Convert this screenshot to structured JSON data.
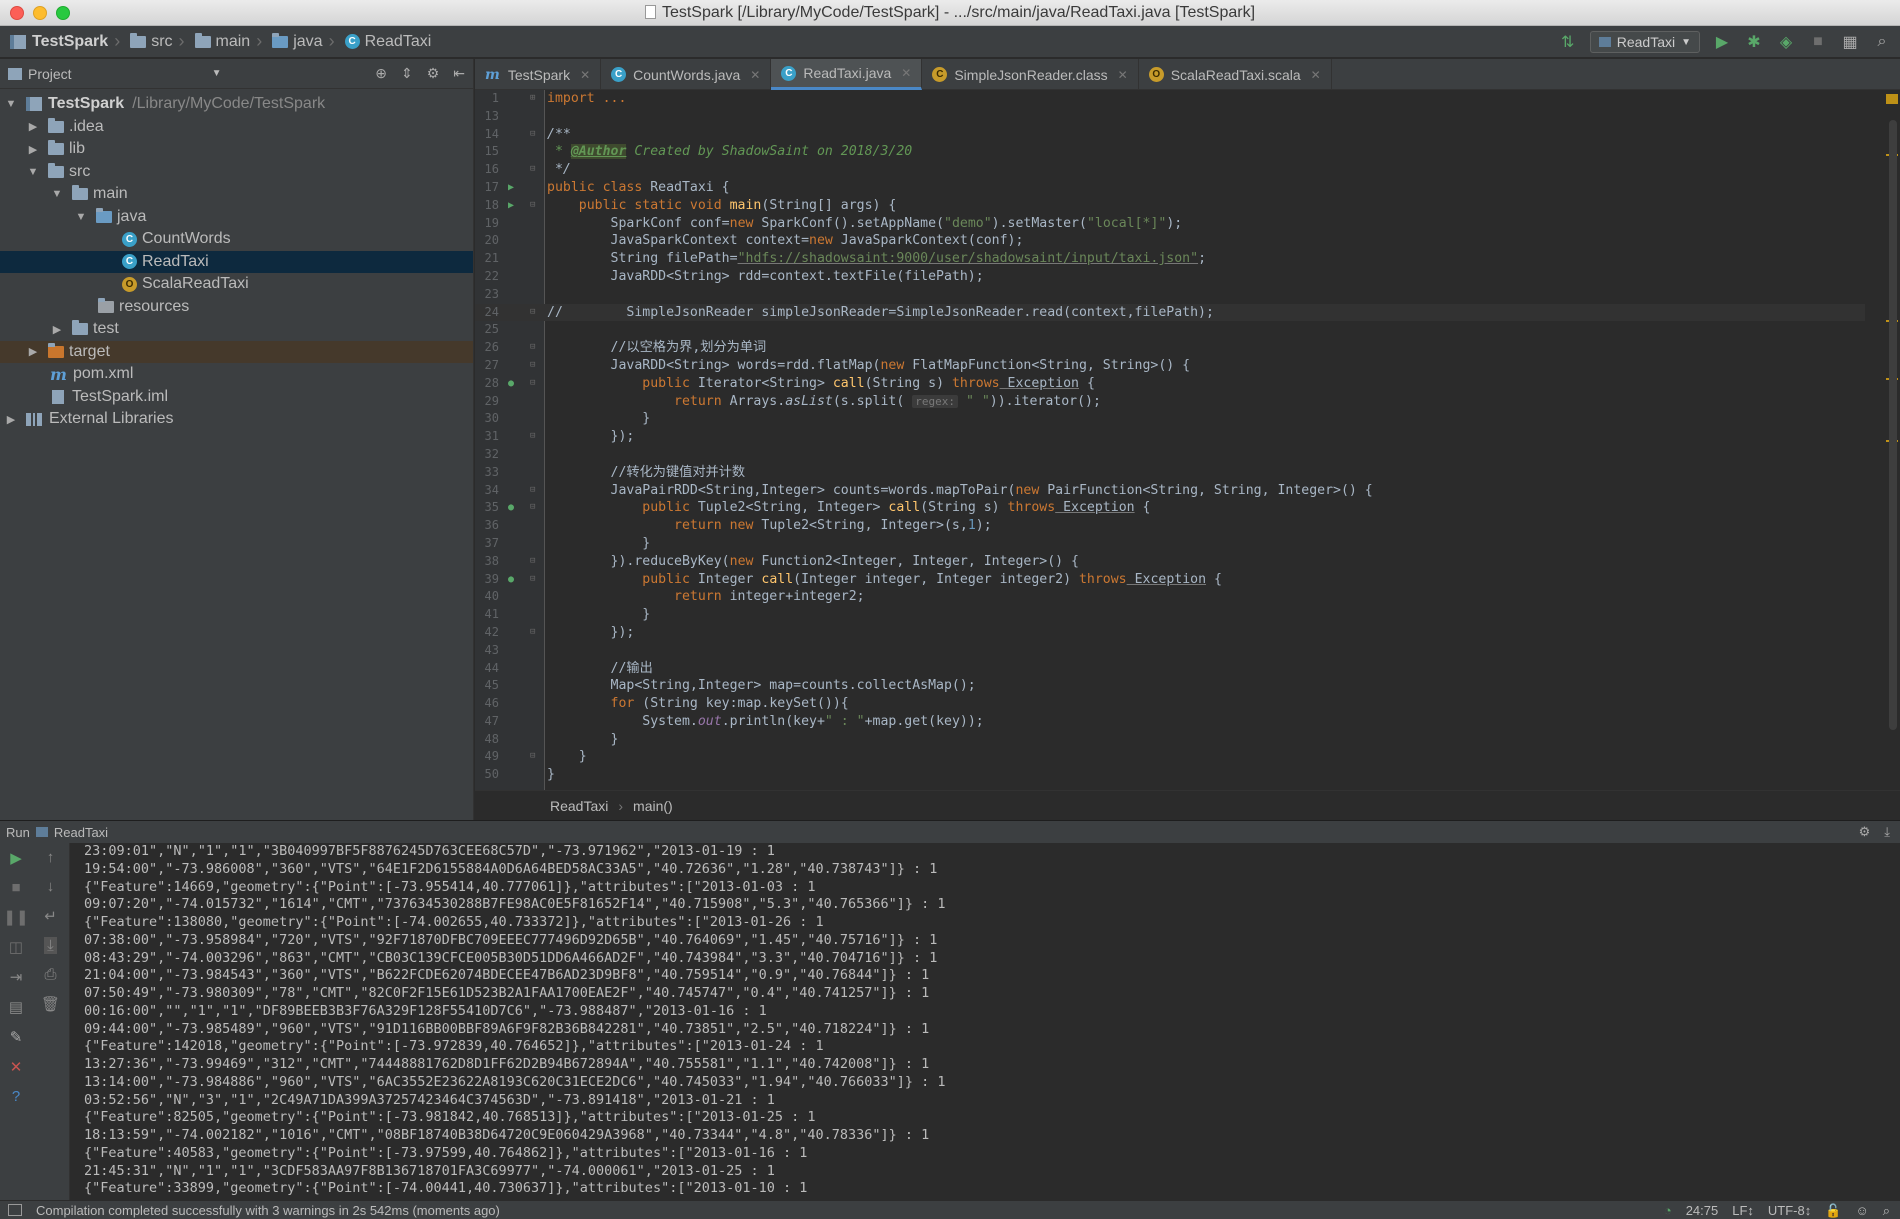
{
  "window": {
    "title": "TestSpark [/Library/MyCode/TestSpark] - .../src/main/java/ReadTaxi.java [TestSpark]"
  },
  "breadcrumbs": [
    "TestSpark",
    "src",
    "main",
    "java",
    "ReadTaxi"
  ],
  "toolbar": {
    "run_config": "ReadTaxi"
  },
  "project_panel": {
    "title": "Project",
    "tree": [
      {
        "label": "TestSpark",
        "path": "/Library/MyCode/TestSpark",
        "depth": 0,
        "expanded": true,
        "icon": "project-icon"
      },
      {
        "label": ".idea",
        "depth": 1,
        "expanded": false,
        "icon": "folder-icon"
      },
      {
        "label": "lib",
        "depth": 1,
        "expanded": false,
        "icon": "folder-icon"
      },
      {
        "label": "src",
        "depth": 1,
        "expanded": true,
        "icon": "folder-icon"
      },
      {
        "label": "main",
        "depth": 2,
        "expanded": true,
        "icon": "folder-icon"
      },
      {
        "label": "java",
        "depth": 3,
        "expanded": true,
        "icon": "source-folder-icon"
      },
      {
        "label": "CountWords",
        "depth": 4,
        "icon": "java-class-icon"
      },
      {
        "label": "ReadTaxi",
        "depth": 4,
        "icon": "java-class-icon",
        "selected": true
      },
      {
        "label": "ScalaReadTaxi",
        "depth": 4,
        "icon": "scala-object-icon"
      },
      {
        "label": "resources",
        "depth": 3,
        "icon": "resources-folder-icon"
      },
      {
        "label": "test",
        "depth": 2,
        "expanded": false,
        "icon": "folder-icon"
      },
      {
        "label": "target",
        "depth": 1,
        "expanded": false,
        "icon": "excluded-folder-icon"
      },
      {
        "label": "pom.xml",
        "depth": 1,
        "icon": "maven-icon"
      },
      {
        "label": "TestSpark.iml",
        "depth": 1,
        "icon": "module-file-icon"
      },
      {
        "label": "External Libraries",
        "depth": 0,
        "expanded": false,
        "icon": "libraries-icon"
      }
    ]
  },
  "tabs": [
    {
      "label": "TestSpark",
      "icon": "maven-icon"
    },
    {
      "label": "CountWords.java",
      "icon": "java-class-icon"
    },
    {
      "label": "ReadTaxi.java",
      "icon": "java-class-icon",
      "active": true
    },
    {
      "label": "SimpleJsonReader.class",
      "icon": "class-file-icon"
    },
    {
      "label": "ScalaReadTaxi.scala",
      "icon": "scala-object-icon"
    }
  ],
  "editor": {
    "line_numbers": [
      "1",
      "13",
      "14",
      "15",
      "16",
      "17",
      "18",
      "19",
      "20",
      "21",
      "22",
      "23",
      "24",
      "25",
      "26",
      "27",
      "28",
      "29",
      "30",
      "31",
      "32",
      "33",
      "34",
      "35",
      "36",
      "37",
      "38",
      "39",
      "40",
      "41",
      "42",
      "43",
      "44",
      "45",
      "46",
      "47",
      "48",
      "49",
      "50"
    ],
    "code": {
      "l1": "import ...",
      "l14": "/**",
      "l15_a": " * ",
      "l15_tag": "@Author",
      "l15_b": " Created by ShadowSaint on 2018/3/20",
      "l16": " */",
      "l17_kw": "public class",
      "l17_b": " ReadTaxi {",
      "l18_kw": "    public static void",
      "l18_fn": " main",
      "l18_b": "(String[] args) {",
      "l19_a": "        SparkConf conf=",
      "l19_kw": "new",
      "l19_b": " SparkConf().setAppName(",
      "l19_s1": "\"demo\"",
      "l19_c": ").setMaster(",
      "l19_s2": "\"local[*]\"",
      "l19_d": ");",
      "l20_a": "        JavaSparkContext context=",
      "l20_kw": "new",
      "l20_b": " JavaSparkContext(conf);",
      "l21_a": "        String filePath=",
      "l21_s": "\"hdfs://shadowsaint:9000/user/shadowsaint/input/taxi.json\"",
      "l21_b": ";",
      "l22": "        JavaRDD<String> rdd=context.textFile(filePath);",
      "l24": "//        SimpleJsonReader simpleJsonReader=SimpleJsonReader.read(context,filePath);",
      "l26": "        //以空格为界,划分为单词",
      "l27_a": "        JavaRDD<String> words=rdd.flatMap(",
      "l27_kw": "new",
      "l27_b": " FlatMapFunction<String, String>() {",
      "l28_kw": "            public",
      "l28_a": " Iterator<String> ",
      "l28_fn": "call",
      "l28_b": "(String s) ",
      "l28_kw2": "throws",
      "l28_ex": " Exception",
      "l28_c": " {",
      "l29_kw": "                return",
      "l29_a": " Arrays.",
      "l29_it": "asList",
      "l29_b": "(s.split( ",
      "l29_hint": "regex:",
      "l29_s": " \" \"",
      "l29_c": ")).iterator();",
      "l30": "            }",
      "l31": "        });",
      "l33": "        //转化为键值对并计数",
      "l34_a": "        JavaPairRDD<String,Integer> counts=words.mapToPair(",
      "l34_kw": "new",
      "l34_b": " PairFunction<String, String, Integer>() {",
      "l35_kw": "            public",
      "l35_a": " Tuple2<String, Integer> ",
      "l35_fn": "call",
      "l35_b": "(String s) ",
      "l35_kw2": "throws",
      "l35_ex": " Exception",
      "l35_c": " {",
      "l36_kw": "                return new",
      "l36_a": " Tuple2<String, Integer>(s,",
      "l36_n": "1",
      "l36_b": ");",
      "l37": "            }",
      "l38_a": "        }).reduceByKey(",
      "l38_kw": "new",
      "l38_b": " Function2<Integer, Integer, Integer>() {",
      "l39_kw": "            public",
      "l39_a": " Integer ",
      "l39_fn": "call",
      "l39_b": "(Integer integer, Integer integer2) ",
      "l39_kw2": "throws",
      "l39_ex": " Exception",
      "l39_c": " {",
      "l40_kw": "                return",
      "l40_a": " integer+integer2;",
      "l41": "            }",
      "l42": "        });",
      "l44": "        //输出",
      "l45": "        Map<String,Integer> map=counts.collectAsMap();",
      "l46_kw": "        for",
      "l46_a": " (String key:map.keySet()){",
      "l47_a": "            System.",
      "l47_it": "out",
      "l47_b": ".println(key+",
      "l47_s": "\" : \"",
      "l47_c": "+map.get(key));",
      "l48": "        }",
      "l49": "    }",
      "l50": "}"
    },
    "footer_crumbs": [
      "ReadTaxi",
      "main()"
    ]
  },
  "run_panel": {
    "label": "Run",
    "config": "ReadTaxi",
    "console_lines": [
      "23:09:01\",\"N\",\"1\",\"1\",\"3B040997BF5F8876245D763CEE68C57D\",\"-73.971962\",\"2013-01-19 : 1",
      "19:54:00\",\"-73.986008\",\"360\",\"VTS\",\"64E1F2D6155884A0D6A64BED58AC33A5\",\"40.72636\",\"1.28\",\"40.738743\"]} : 1",
      "{\"Feature\":14669,\"geometry\":{\"Point\":[-73.955414,40.777061]},\"attributes\":[\"2013-01-03 : 1",
      "09:07:20\",\"-74.015732\",\"1614\",\"CMT\",\"737634530288B7FE98AC0E5F81652F14\",\"40.715908\",\"5.3\",\"40.765366\"]} : 1",
      "{\"Feature\":138080,\"geometry\":{\"Point\":[-74.002655,40.733372]},\"attributes\":[\"2013-01-26 : 1",
      "07:38:00\",\"-73.958984\",\"720\",\"VTS\",\"92F71870DFBC709EEEC777496D92D65B\",\"40.764069\",\"1.45\",\"40.75716\"]} : 1",
      "08:43:29\",\"-74.003296\",\"863\",\"CMT\",\"CB03C139CFCE005B30D51DD6A466AD2F\",\"40.743984\",\"3.3\",\"40.704716\"]} : 1",
      "21:04:00\",\"-73.984543\",\"360\",\"VTS\",\"B622FCDE62074BDECEE47B6AD23D9BF8\",\"40.759514\",\"0.9\",\"40.76844\"]} : 1",
      "07:50:49\",\"-73.980309\",\"78\",\"CMT\",\"82C0F2F15E61D523B2A1FAA1700EAE2F\",\"40.745747\",\"0.4\",\"40.741257\"]} : 1",
      "00:16:00\",\"\",\"1\",\"1\",\"DF89BEEB3B3F76A329F128F55410D7C6\",\"-73.988487\",\"2013-01-16 : 1",
      "09:44:00\",\"-73.985489\",\"960\",\"VTS\",\"91D116BB00BBF89A6F9F82B36B842281\",\"40.73851\",\"2.5\",\"40.718224\"]} : 1",
      "{\"Feature\":142018,\"geometry\":{\"Point\":[-73.972839,40.764652]},\"attributes\":[\"2013-01-24 : 1",
      "13:27:36\",\"-73.99469\",\"312\",\"CMT\",\"74448881762D8D1FF62D2B94B672894A\",\"40.755581\",\"1.1\",\"40.742008\"]} : 1",
      "13:14:00\",\"-73.984886\",\"960\",\"VTS\",\"6AC3552E23622A8193C620C31ECE2DC6\",\"40.745033\",\"1.94\",\"40.766033\"]} : 1",
      "03:52:56\",\"N\",\"3\",\"1\",\"2C49A71DA399A37257423464C374563D\",\"-73.891418\",\"2013-01-21 : 1",
      "{\"Feature\":82505,\"geometry\":{\"Point\":[-73.981842,40.768513]},\"attributes\":[\"2013-01-25 : 1",
      "18:13:59\",\"-74.002182\",\"1016\",\"CMT\",\"08BF18740B38D64720C9E060429A3968\",\"40.73344\",\"4.8\",\"40.78336\"]} : 1",
      "{\"Feature\":40583,\"geometry\":{\"Point\":[-73.97599,40.764862]},\"attributes\":[\"2013-01-16 : 1",
      "21:45:31\",\"N\",\"1\",\"1\",\"3CDF583AA97F8B136718701FA3C69977\",\"-74.000061\",\"2013-01-25 : 1",
      "{\"Feature\":33899,\"geometry\":{\"Point\":[-74.00441,40.730637]},\"attributes\":[\"2013-01-10 : 1"
    ]
  },
  "status_bar": {
    "message": "Compilation completed successfully with 3 warnings in 2s 542ms (moments ago)",
    "position": "24:75",
    "line_sep": "LF↕",
    "encoding": "UTF-8↕"
  },
  "colors": {
    "accent": "#4a88c7",
    "background": "#2b2b2b",
    "panel": "#3c3f41",
    "run_green": "#59a869"
  }
}
